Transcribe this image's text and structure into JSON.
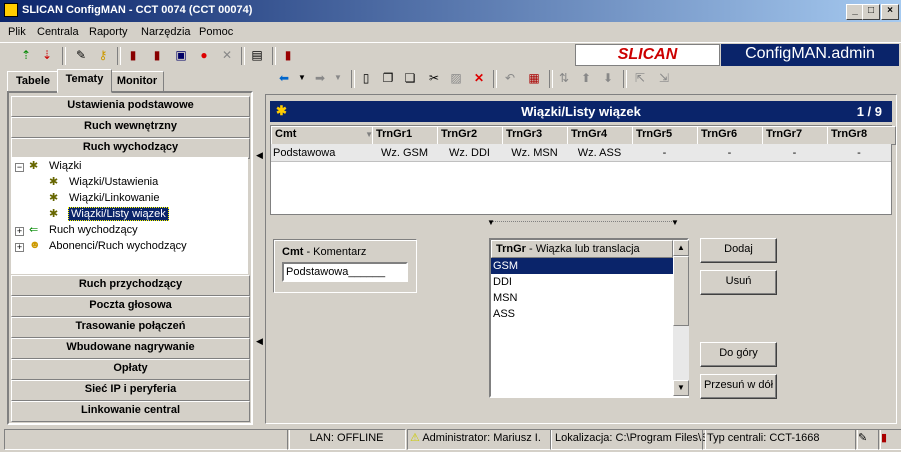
{
  "window": {
    "title": "SLICAN ConfigMAN - CCT 0074 (CCT 00074)",
    "minimize": "_",
    "maximize": "□",
    "close": "×"
  },
  "menu": [
    "Plik",
    "Centrala",
    "Raporty",
    "Narzędzia",
    "Pomoc"
  ],
  "brand": {
    "logo": "SLICAN",
    "app": "ConfigMAN.admin"
  },
  "tabs": [
    "Tabele",
    "Tematy",
    "Monitor"
  ],
  "categories_top": [
    "Ustawienia podstawowe",
    "Ruch wewnętrzny",
    "Ruch wychodzący"
  ],
  "tree": {
    "root": "Wiązki",
    "children": [
      "Wiązki/Ustawienia",
      "Wiązki/Linkowanie",
      "Wiązki/Listy wiązek"
    ],
    "siblings": [
      "Ruch wychodzący",
      "Abonenci/Ruch wychodzący"
    ]
  },
  "categories_bottom": [
    "Ruch przychodzący",
    "Poczta głosowa",
    "Trasowanie połączeń",
    "Wbudowane nagrywanie",
    "Opłaty",
    "Sieć IP i peryferia",
    "Linkowanie central"
  ],
  "panel": {
    "title": "Wiązki/Listy wiązek",
    "page": "1 / 9"
  },
  "grid": {
    "headers": [
      "Cmt",
      "TrnGr1",
      "TrnGr2",
      "TrnGr3",
      "TrnGr4",
      "TrnGr5",
      "TrnGr6",
      "TrnGr7",
      "TrnGr8"
    ],
    "row": [
      "Podstawowa",
      "Wz. GSM",
      "Wz. DDI",
      "Wz. MSN",
      "Wz. ASS",
      "-",
      "-",
      "-",
      "-"
    ]
  },
  "comment": {
    "label_bold": "Cmt",
    "label_rest": " - Komentarz",
    "value": "Podstawowa______"
  },
  "trngr": {
    "label_bold": "TrnGr",
    "label_rest": " - Wiązka lub translacja",
    "items": [
      "GSM",
      "DDI",
      "MSN",
      "ASS"
    ]
  },
  "buttons": {
    "add": "Dodaj",
    "remove": "Usuń",
    "up": "Do góry",
    "down": "Przesuń w dół"
  },
  "statusbar": {
    "lan": "LAN: OFFLINE",
    "user": "Administrator: Mariusz I.",
    "location": "Lokalizacja: C:\\Program Files\\S",
    "type": "Typ centrali: CCT-1668"
  }
}
